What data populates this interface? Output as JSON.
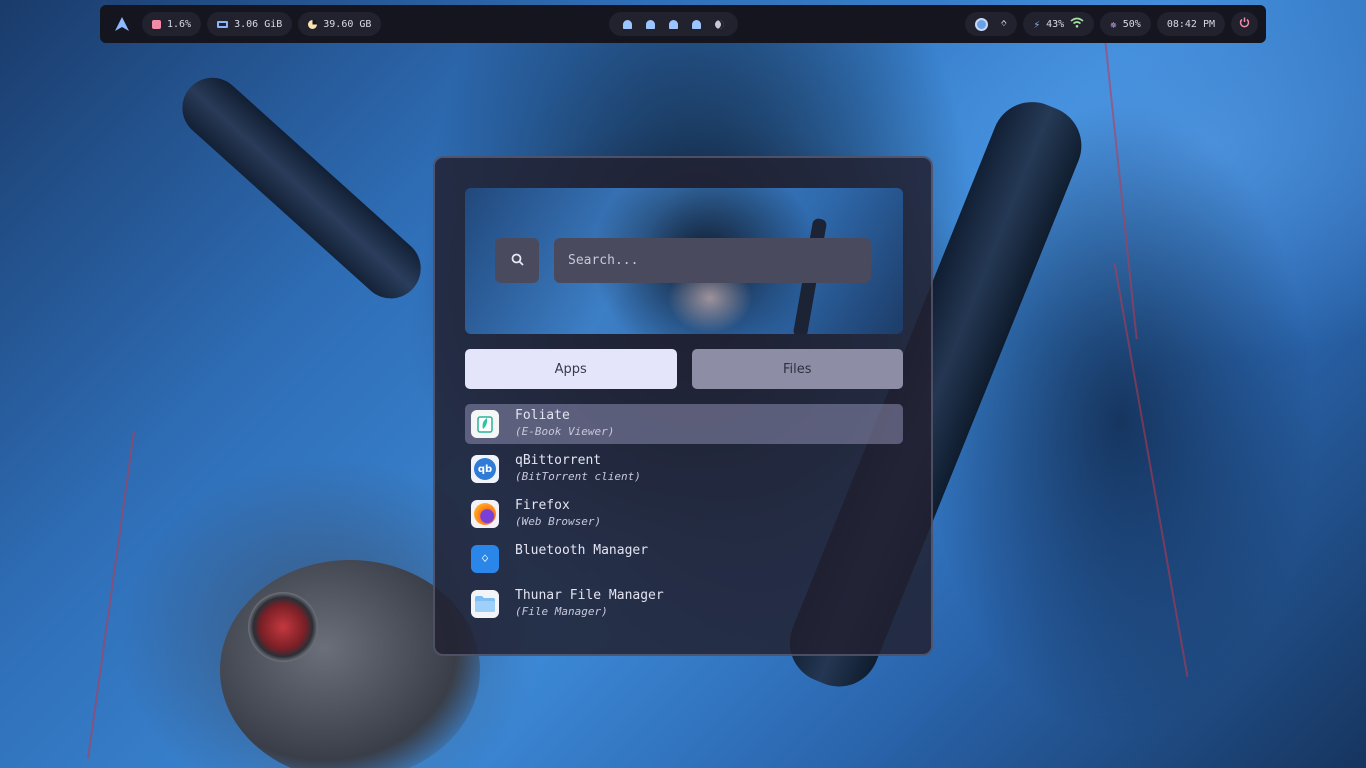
{
  "topbar": {
    "cpu": "1.6%",
    "ram": "3.06 GiB",
    "disk": "39.60 GB",
    "battery": "43%",
    "brightness": "50%",
    "clock": "08:42 PM",
    "icons": {
      "launcher": "arch-logo-icon",
      "cpu": "cpu-icon",
      "ram": "memory-icon",
      "disk": "disk-icon",
      "vpn": "network-globe-icon",
      "bluetooth": "bluetooth-icon",
      "charge": "charging-icon",
      "wifi": "wifi-icon",
      "brightness": "brightness-icon",
      "power": "power-icon"
    },
    "workspaces": [
      "ghost-icon",
      "ghost-icon",
      "ghost-icon",
      "ghost-icon",
      "moon-icon"
    ],
    "colors": {
      "bar_bg": "#151520",
      "pill_bg": "#22222f",
      "cpu": "#f38ba8",
      "ram": "#89b4fa",
      "disk": "#f9e2af",
      "charge": "#89b4fa",
      "wifi": "#a6e3a1",
      "brightness": "#cba6f7",
      "power": "#f38ba8"
    }
  },
  "launcher": {
    "search": {
      "placeholder": "Search...",
      "value": ""
    },
    "tabs": [
      {
        "label": "Apps",
        "active": true
      },
      {
        "label": "Files",
        "active": false
      }
    ],
    "apps": [
      {
        "name": "Foliate",
        "desc": "(E-Book Viewer)",
        "icon": "foliate-icon",
        "selected": true
      },
      {
        "name": "qBittorrent",
        "desc": "(BitTorrent client)",
        "icon": "qbittorrent-icon",
        "selected": false
      },
      {
        "name": "Firefox",
        "desc": "(Web Browser)",
        "icon": "firefox-icon",
        "selected": false
      },
      {
        "name": "Bluetooth Manager",
        "desc": "",
        "icon": "bluetooth-manager-icon",
        "selected": false
      },
      {
        "name": "Thunar File Manager",
        "desc": "(File Manager)",
        "icon": "thunar-icon",
        "selected": false
      }
    ]
  }
}
